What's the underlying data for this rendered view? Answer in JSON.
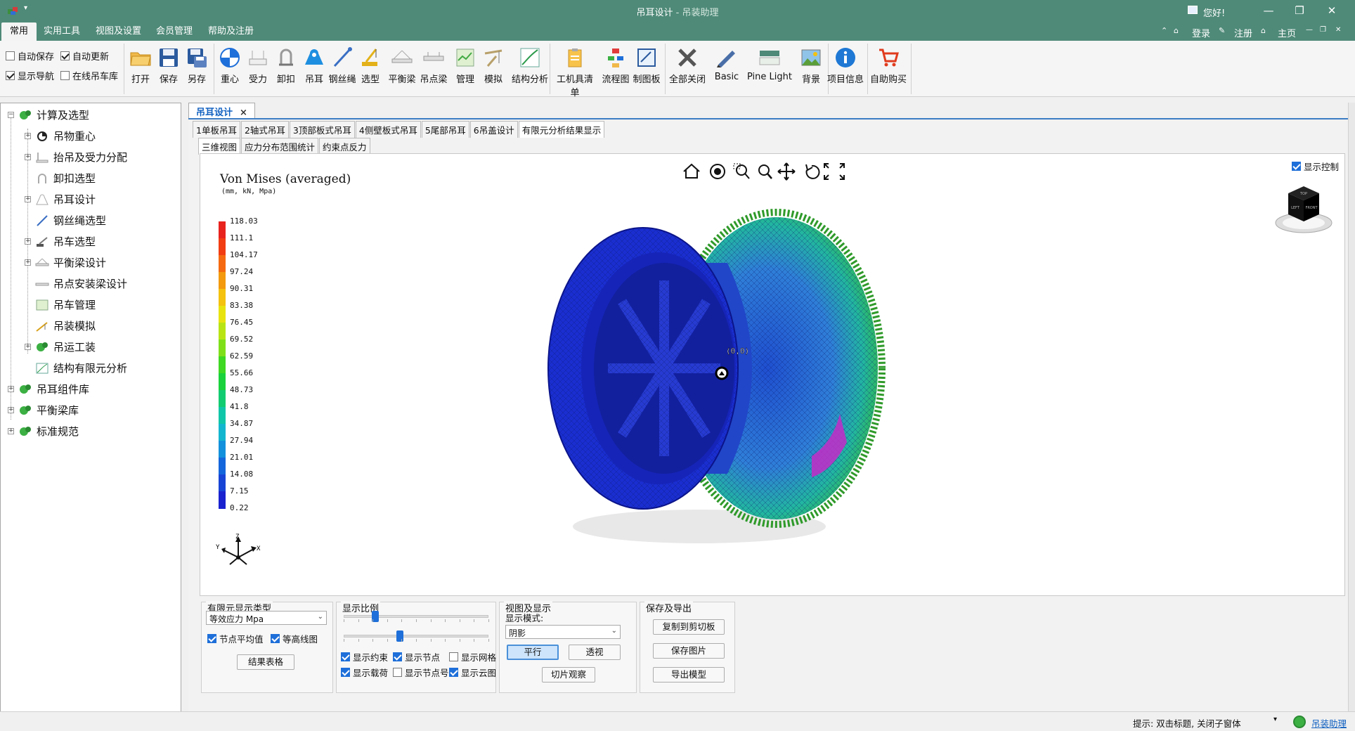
{
  "window": {
    "title": "吊耳设计",
    "title_sep": " - ",
    "subtitle": "吊装助理",
    "greeting": "您好!",
    "buttons": [
      "—",
      "❐",
      "✕"
    ]
  },
  "menubar": {
    "items": [
      "常用",
      "实用工具",
      "视图及设置",
      "会员管理",
      "帮助及注册"
    ],
    "right": [
      "登录",
      "注册",
      "主页"
    ]
  },
  "ribbon": {
    "checks": [
      {
        "label": "自动保存",
        "checked": false
      },
      {
        "label": "自动更新",
        "checked": true
      },
      {
        "label": "显示导航",
        "checked": true
      },
      {
        "label": "在线吊车库",
        "checked": false
      }
    ],
    "buttons": [
      "打开",
      "保存",
      "另存",
      "重心",
      "受力",
      "卸扣",
      "吊耳",
      "钢丝绳",
      "选型",
      "平衡梁",
      "吊点梁",
      "管理",
      "模拟",
      "结构分析",
      "工机具清单",
      "流程图",
      "制图板",
      "全部关闭",
      "Basic",
      "Pine Light",
      "背景",
      "项目信息",
      "自助购买"
    ]
  },
  "tree": {
    "root": "计算及选型",
    "children": [
      "吊物重心",
      "抬吊及受力分配",
      "卸扣选型",
      "吊耳设计",
      "钢丝绳选型",
      "吊车选型",
      "平衡梁设计",
      "吊点安装梁设计",
      "吊车管理",
      "吊装模拟",
      "吊运工装",
      "结构有限元分析"
    ],
    "others": [
      "吊耳组件库",
      "平衡梁库",
      "标准规范"
    ]
  },
  "doc_tab": {
    "label": "吊耳设计",
    "close": "×"
  },
  "subtabs": [
    "1单板吊耳",
    "2轴式吊耳",
    "3顶部板式吊耳",
    "4侧壁板式吊耳",
    "5尾部吊耳",
    "6吊盖设计",
    "有限元分析结果显示"
  ],
  "view_tabs": [
    "三维视图",
    "应力分布范围统计",
    "约束点反力"
  ],
  "viewport": {
    "title": "Von Mises (averaged)",
    "units": "(mm, kN, Mpa)",
    "show_control": "显示控制",
    "node_label": "(0,0)",
    "axes": {
      "x": "X",
      "y": "Y",
      "z": "Z"
    },
    "cube_faces": {
      "top": "TOP",
      "left": "LEFT",
      "front": "FRONT"
    },
    "legend_values": [
      "118.03",
      "111.1",
      "104.17",
      "97.24",
      "90.31",
      "83.38",
      "76.45",
      "69.52",
      "62.59",
      "55.66",
      "48.73",
      "41.8",
      "34.87",
      "27.94",
      "21.01",
      "14.08",
      "7.15",
      "0.22"
    ],
    "legend_colors": [
      "#e8231e",
      "#f23d12",
      "#f56a10",
      "#f39a0e",
      "#f4c20f",
      "#e8e30f",
      "#b9e414",
      "#7fe01a",
      "#3fd822",
      "#19d23c",
      "#12cc72",
      "#10c6a8",
      "#12b6cf",
      "#1290dc",
      "#1466dc",
      "#1844d6",
      "#1a22cf"
    ]
  },
  "bottom": {
    "fe_type": {
      "title": "有限元显示类型",
      "select": "等效应力 Mpa",
      "chk_avg": "节点平均值",
      "chk_contour": "等高线图",
      "button": "结果表格"
    },
    "scale": {
      "title": "显示比例",
      "slider1": 0.22,
      "slider2": 0.39,
      "checks": [
        {
          "label": "显示约束",
          "checked": true
        },
        {
          "label": "显示节点",
          "checked": true
        },
        {
          "label": "显示网格",
          "checked": false
        },
        {
          "label": "显示载荷",
          "checked": true
        },
        {
          "label": "显示节点号",
          "checked": false
        },
        {
          "label": "显示云图",
          "checked": true
        }
      ]
    },
    "view": {
      "title": "视图及显示",
      "mode_label": "显示模式:",
      "mode_value": "阴影",
      "btn_parallel": "平行",
      "btn_persp": "透视",
      "btn_slice": "切片观察"
    },
    "export": {
      "title": "保存及导出",
      "btn_copy": "复制到剪切板",
      "btn_save": "保存图片",
      "btn_export": "导出模型"
    }
  },
  "status": {
    "hint": "提示: 双击标题, 关闭子窗体",
    "link": "吊装助理"
  }
}
